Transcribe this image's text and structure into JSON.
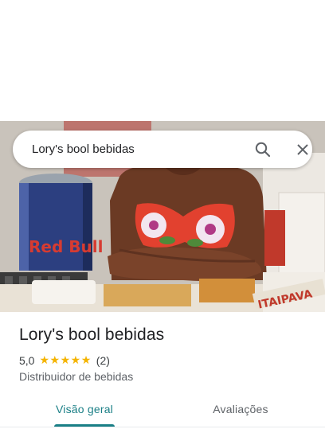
{
  "search": {
    "query": "Lory's bool bebidas"
  },
  "place": {
    "name": "Lory's bool bebidas",
    "rating": "5,0",
    "stars": 5,
    "review_count": "(2)",
    "category": "Distribuidor de bebidas"
  },
  "hero_photo": {
    "can_text": "Red Bull",
    "crate_text": "ITAIPAVA"
  },
  "tabs": [
    {
      "label": "Visão geral",
      "selected": true
    },
    {
      "label": "Avaliações",
      "selected": false
    }
  ],
  "colors": {
    "accent": "#1a7f86",
    "star": "#f4b400",
    "text_primary": "#202124",
    "text_secondary": "#5f6368"
  },
  "icons": [
    "search-icon",
    "close-icon",
    "star-icon"
  ]
}
